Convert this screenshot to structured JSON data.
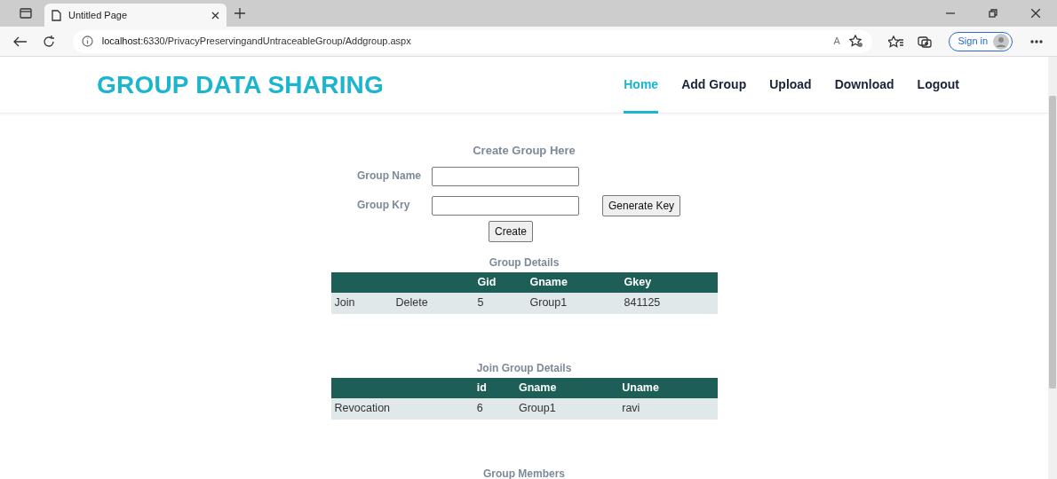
{
  "browser": {
    "tab_title": "Untitled Page",
    "address_host": "localhost",
    "address_rest": ":6330/PrivacyPreservingandUntraceableGroup/Addgroup.aspx",
    "read_aloud": "A",
    "sign_in": "Sign in"
  },
  "header": {
    "logo": "GROUP DATA SHARING",
    "nav": [
      {
        "label": "Home",
        "selected": true
      },
      {
        "label": "Add Group",
        "selected": false
      },
      {
        "label": "Upload",
        "selected": false
      },
      {
        "label": "Download",
        "selected": false
      },
      {
        "label": "Logout",
        "selected": false
      }
    ]
  },
  "form": {
    "title": "Create Group Here",
    "fields": [
      {
        "label": "Group Name"
      },
      {
        "label": "Group Kry",
        "button": "Generate Key"
      }
    ],
    "submit": "Create"
  },
  "tables": [
    {
      "title": "Group Details",
      "columns": [
        "Gid",
        "Gname",
        "Gkey"
      ],
      "rows": [
        {
          "actions": [
            "Join",
            "Delete"
          ],
          "cells": [
            "5",
            "Group1",
            "841125"
          ]
        }
      ]
    },
    {
      "title": "Join Group Details",
      "columns": [
        "id",
        "Gname",
        "Uname"
      ],
      "rows": [
        {
          "actions": [
            "Revocation"
          ],
          "cells": [
            "6",
            "Group1",
            "ravi"
          ]
        }
      ]
    }
  ],
  "section_title": "Group Members"
}
